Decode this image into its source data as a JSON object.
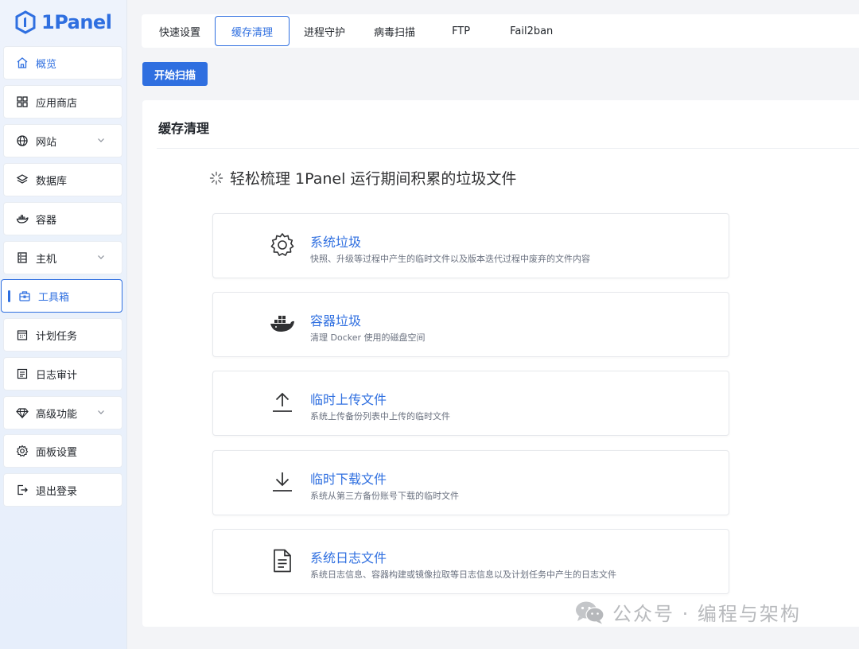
{
  "app": {
    "logo_text": "1Panel",
    "accent_color": "#2f6fe0"
  },
  "sidebar": {
    "items": [
      {
        "label": "概览",
        "icon": "home-icon"
      },
      {
        "label": "应用商店",
        "icon": "grid-icon"
      },
      {
        "label": "网站",
        "icon": "globe-icon",
        "has_submenu": true
      },
      {
        "label": "数据库",
        "icon": "layers-icon"
      },
      {
        "label": "容器",
        "icon": "docker-icon"
      },
      {
        "label": "主机",
        "icon": "server-icon",
        "has_submenu": true
      },
      {
        "label": "工具箱",
        "icon": "toolbox-icon",
        "selected": true
      },
      {
        "label": "计划任务",
        "icon": "calendar-icon"
      },
      {
        "label": "日志审计",
        "icon": "log-icon"
      },
      {
        "label": "高级功能",
        "icon": "diamond-icon",
        "has_submenu": true
      },
      {
        "label": "面板设置",
        "icon": "gear-icon"
      },
      {
        "label": "退出登录",
        "icon": "logout-icon"
      }
    ]
  },
  "tabs": [
    {
      "label": "快速设置"
    },
    {
      "label": "缓存清理",
      "active": true
    },
    {
      "label": "进程守护"
    },
    {
      "label": "病毒扫描"
    },
    {
      "label": "FTP"
    },
    {
      "label": "Fail2ban"
    }
  ],
  "toolbar": {
    "scan_label": "开始扫描"
  },
  "main": {
    "title": "缓存清理",
    "subtitle": "轻松梳理 1Panel 运行期间积累的垃圾文件",
    "items": [
      {
        "title": "系统垃圾",
        "desc": "快照、升级等过程中产生的临时文件以及版本迭代过程中废弃的文件内容",
        "icon": "gear-icon"
      },
      {
        "title": "容器垃圾",
        "desc": "清理 Docker 使用的磁盘空间",
        "icon": "docker-icon"
      },
      {
        "title": "临时上传文件",
        "desc": "系统上传备份列表中上传的临时文件",
        "icon": "upload-icon"
      },
      {
        "title": "临时下载文件",
        "desc": "系统从第三方备份账号下载的临时文件",
        "icon": "download-icon"
      },
      {
        "title": "系统日志文件",
        "desc": "系统日志信息、容器构建或镜像拉取等日志信息以及计划任务中产生的日志文件",
        "icon": "document-icon"
      }
    ]
  },
  "watermark": {
    "text": "公众号 · 编程与架构",
    "icon": "wechat-icon"
  }
}
